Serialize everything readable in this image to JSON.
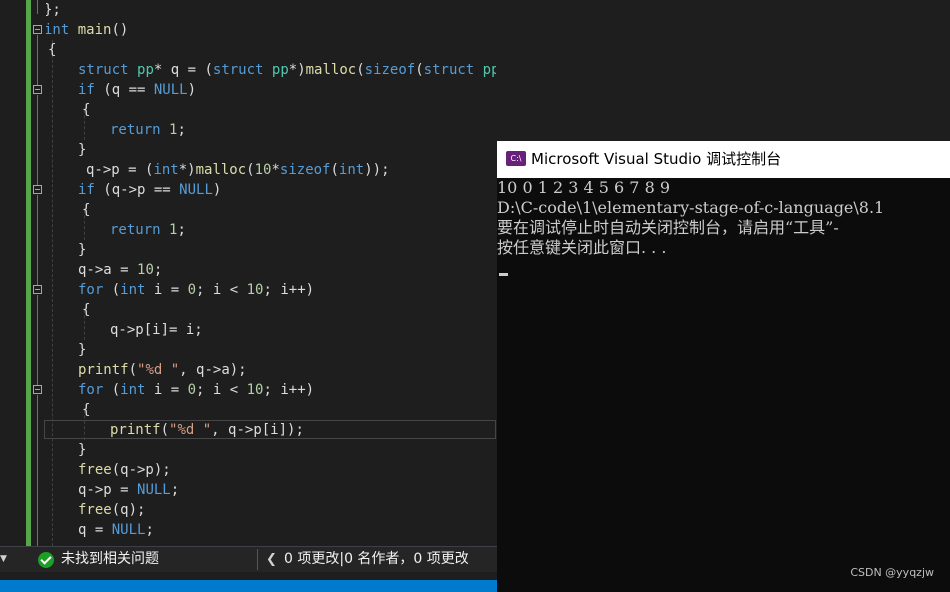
{
  "editor": {
    "lines": [
      {
        "tokens": [
          {
            "t": "};",
            "c": "p"
          }
        ]
      },
      {
        "tokens": [
          {
            "t": "int",
            "c": "kw"
          },
          {
            "t": " ",
            "c": "p"
          },
          {
            "t": "main",
            "c": "fn"
          },
          {
            "t": "()",
            "c": "p"
          }
        ]
      },
      {
        "tokens": [
          {
            "t": "{",
            "c": "p"
          }
        ]
      },
      {
        "tokens": [
          {
            "t": "struct",
            "c": "kw"
          },
          {
            "t": " ",
            "c": "p"
          },
          {
            "t": "pp",
            "c": "ty"
          },
          {
            "t": "* q = (",
            "c": "p"
          },
          {
            "t": "struct",
            "c": "kw"
          },
          {
            "t": " ",
            "c": "p"
          },
          {
            "t": "pp",
            "c": "ty"
          },
          {
            "t": "*)",
            "c": "p"
          },
          {
            "t": "malloc",
            "c": "fn"
          },
          {
            "t": "(",
            "c": "p"
          },
          {
            "t": "sizeof",
            "c": "kw"
          },
          {
            "t": "(",
            "c": "p"
          },
          {
            "t": "struct",
            "c": "kw"
          },
          {
            "t": " ",
            "c": "p"
          },
          {
            "t": "pp",
            "c": "ty"
          },
          {
            "t": "));",
            "c": "p"
          }
        ]
      },
      {
        "tokens": [
          {
            "t": "if",
            "c": "kw"
          },
          {
            "t": " (q == ",
            "c": "p"
          },
          {
            "t": "NULL",
            "c": "kw"
          },
          {
            "t": ")",
            "c": "p"
          }
        ]
      },
      {
        "tokens": [
          {
            "t": "{",
            "c": "p"
          }
        ]
      },
      {
        "tokens": [
          {
            "t": "return",
            "c": "kw"
          },
          {
            "t": " ",
            "c": "p"
          },
          {
            "t": "1",
            "c": "nu"
          },
          {
            "t": ";",
            "c": "p"
          }
        ]
      },
      {
        "tokens": [
          {
            "t": "}",
            "c": "p"
          }
        ]
      },
      {
        "tokens": [
          {
            "t": "q->p = (",
            "c": "p"
          },
          {
            "t": "int",
            "c": "kw"
          },
          {
            "t": "*)",
            "c": "p"
          },
          {
            "t": "malloc",
            "c": "fn"
          },
          {
            "t": "(",
            "c": "p"
          },
          {
            "t": "10",
            "c": "nu"
          },
          {
            "t": "*",
            "c": "p"
          },
          {
            "t": "sizeof",
            "c": "kw"
          },
          {
            "t": "(",
            "c": "p"
          },
          {
            "t": "int",
            "c": "kw"
          },
          {
            "t": "));",
            "c": "p"
          }
        ]
      },
      {
        "tokens": [
          {
            "t": "if",
            "c": "kw"
          },
          {
            "t": " (q->p == ",
            "c": "p"
          },
          {
            "t": "NULL",
            "c": "kw"
          },
          {
            "t": ")",
            "c": "p"
          }
        ]
      },
      {
        "tokens": [
          {
            "t": "{",
            "c": "p"
          }
        ]
      },
      {
        "tokens": [
          {
            "t": "return",
            "c": "kw"
          },
          {
            "t": " ",
            "c": "p"
          },
          {
            "t": "1",
            "c": "nu"
          },
          {
            "t": ";",
            "c": "p"
          }
        ]
      },
      {
        "tokens": [
          {
            "t": "}",
            "c": "p"
          }
        ]
      },
      {
        "tokens": [
          {
            "t": "q->a = ",
            "c": "p"
          },
          {
            "t": "10",
            "c": "nu"
          },
          {
            "t": ";",
            "c": "p"
          }
        ]
      },
      {
        "tokens": [
          {
            "t": "for",
            "c": "kw"
          },
          {
            "t": " (",
            "c": "p"
          },
          {
            "t": "int",
            "c": "kw"
          },
          {
            "t": " i = ",
            "c": "p"
          },
          {
            "t": "0",
            "c": "nu"
          },
          {
            "t": "; i < ",
            "c": "p"
          },
          {
            "t": "10",
            "c": "nu"
          },
          {
            "t": "; i++)",
            "c": "p"
          }
        ]
      },
      {
        "tokens": [
          {
            "t": "{",
            "c": "p"
          }
        ]
      },
      {
        "tokens": [
          {
            "t": "q->p[i]= i;",
            "c": "p"
          }
        ]
      },
      {
        "tokens": [
          {
            "t": "}",
            "c": "p"
          }
        ]
      },
      {
        "tokens": [
          {
            "t": "printf",
            "c": "fn"
          },
          {
            "t": "(",
            "c": "p"
          },
          {
            "t": "\"%d \"",
            "c": "st"
          },
          {
            "t": ", q->a);",
            "c": "p"
          }
        ]
      },
      {
        "tokens": [
          {
            "t": "for",
            "c": "kw"
          },
          {
            "t": " (",
            "c": "p"
          },
          {
            "t": "int",
            "c": "kw"
          },
          {
            "t": " i = ",
            "c": "p"
          },
          {
            "t": "0",
            "c": "nu"
          },
          {
            "t": "; i < ",
            "c": "p"
          },
          {
            "t": "10",
            "c": "nu"
          },
          {
            "t": "; i++)",
            "c": "p"
          }
        ]
      },
      {
        "tokens": [
          {
            "t": "{",
            "c": "p"
          }
        ]
      },
      {
        "tokens": [
          {
            "t": "printf",
            "c": "fn"
          },
          {
            "t": "(",
            "c": "p"
          },
          {
            "t": "\"%d \"",
            "c": "st"
          },
          {
            "t": ", q->p[i]);",
            "c": "p"
          }
        ]
      },
      {
        "tokens": [
          {
            "t": "}",
            "c": "p"
          }
        ]
      },
      {
        "tokens": [
          {
            "t": "free",
            "c": "fn"
          },
          {
            "t": "(q->p);",
            "c": "p"
          }
        ]
      },
      {
        "tokens": [
          {
            "t": "q->p = ",
            "c": "p"
          },
          {
            "t": "NULL",
            "c": "kw"
          },
          {
            "t": ";",
            "c": "p"
          }
        ]
      },
      {
        "tokens": [
          {
            "t": "free",
            "c": "fn"
          },
          {
            "t": "(q);",
            "c": "p"
          }
        ]
      },
      {
        "tokens": [
          {
            "t": "q = ",
            "c": "p"
          },
          {
            "t": "NULL",
            "c": "kw"
          },
          {
            "t": ";",
            "c": "p"
          }
        ]
      }
    ]
  },
  "statusbar": {
    "issues": "未找到相关问题",
    "changes": "0 项更改|0 名作者，0 项更改"
  },
  "console": {
    "title": "Microsoft Visual Studio 调试控制台",
    "icon_label": "C:\\",
    "output": [
      "10 0 1 2 3 4 5 6 7 8 9",
      "D:\\C-code\\1\\elementary-stage-of-c-language\\8.1",
      "要在调试停止时自动关闭控制台，请启用“工具”-",
      "按任意键关闭此窗口. . ."
    ]
  },
  "watermark": "CSDN @yyqzjw",
  "colors": {
    "editor_bg": "#1e1e1e",
    "keyword": "#569cd6",
    "type": "#4ec9b0",
    "function": "#dcdcaa",
    "string": "#d69d85",
    "number": "#b5cea8",
    "change_bar": "#57a64a",
    "console_bg": "#0c0c0c",
    "status_blue": "#007acc"
  }
}
